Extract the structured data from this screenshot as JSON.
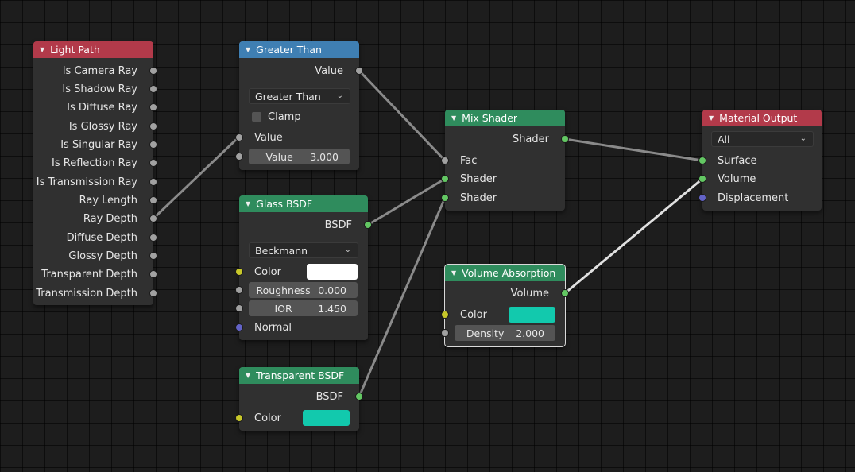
{
  "colors": {
    "background": "#1d1d1d",
    "node_body": "#303030",
    "header_input": "#b23a4a",
    "header_converter": "#3f7fb3",
    "header_shader": "#2f8c5d",
    "socket_float": "#a1a1a1",
    "socket_shader": "#63c763",
    "socket_color": "#c7c729",
    "socket_vector": "#6363c7",
    "wire": "#8a8a8a",
    "wire_selected": "#e0e0e0",
    "white_swatch": "#ffffff",
    "teal_swatch": "#12c9ad"
  },
  "icons": {
    "collapse": "▼",
    "chevron": "⌄"
  },
  "light_path": {
    "title": "Light Path",
    "outputs": [
      "Is Camera Ray",
      "Is Shadow Ray",
      "Is Diffuse Ray",
      "Is Glossy Ray",
      "Is Singular Ray",
      "Is Reflection Ray",
      "Is Transmission Ray",
      "Ray Length",
      "Ray Depth",
      "Diffuse Depth",
      "Glossy Depth",
      "Transparent Depth",
      "Transmission Depth"
    ]
  },
  "greater_than": {
    "title": "Greater Than",
    "output": "Value",
    "operation": "Greater Than",
    "clamp_label": "Clamp",
    "input_value": "Value",
    "value_field_label": "Value",
    "value_field_value": "3.000"
  },
  "glass_bsdf": {
    "title": "Glass BSDF",
    "output": "BSDF",
    "distribution": "Beckmann",
    "color_label": "Color",
    "roughness_label": "Roughness",
    "roughness_value": "0.000",
    "ior_label": "IOR",
    "ior_value": "1.450",
    "normal_label": "Normal"
  },
  "transparent_bsdf": {
    "title": "Transparent BSDF",
    "output": "BSDF",
    "color_label": "Color"
  },
  "mix_shader": {
    "title": "Mix Shader",
    "output": "Shader",
    "fac_label": "Fac",
    "shader1_label": "Shader",
    "shader2_label": "Shader"
  },
  "volume_absorption": {
    "title": "Volume Absorption",
    "output": "Volume",
    "color_label": "Color",
    "density_label": "Density",
    "density_value": "2.000"
  },
  "material_output": {
    "title": "Material Output",
    "target": "All",
    "surface_label": "Surface",
    "volume_label": "Volume",
    "displacement_label": "Displacement"
  }
}
